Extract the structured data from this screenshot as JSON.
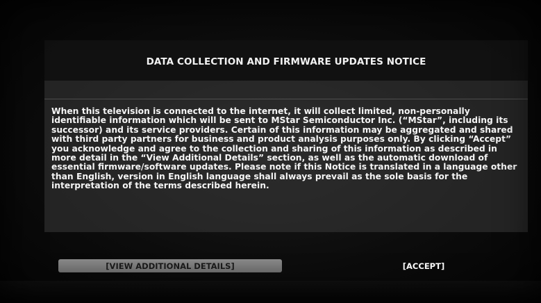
{
  "dialog": {
    "title": "DATA COLLECTION AND FIRMWARE UPDATES NOTICE",
    "lines": [
      "When this television is connected to the internet, it will collect limited, non-personally",
      "identifiable information which will be sent to MStar Semiconductor Inc. (“MStar”, including its",
      "successor) and its service providers. Certain of this information may be aggregated and shared",
      "with third party partners for business and product analysis purposes only. By clicking “Accept”",
      "you acknowledge and agree to the collection and sharing of this information as described in",
      "more detail in the “View Additional Details” section, as well as the automatic download of",
      "essential firmware/software updates. Please note if this Notice is translated in a language other",
      "than English, version in English language shall always prevail as the sole basis for the",
      "interpretation of the terms described herein."
    ]
  },
  "buttons": {
    "view_details_label": "[VIEW ADDITIONAL DETAILS]",
    "accept_label": "[ACCEPT]"
  }
}
